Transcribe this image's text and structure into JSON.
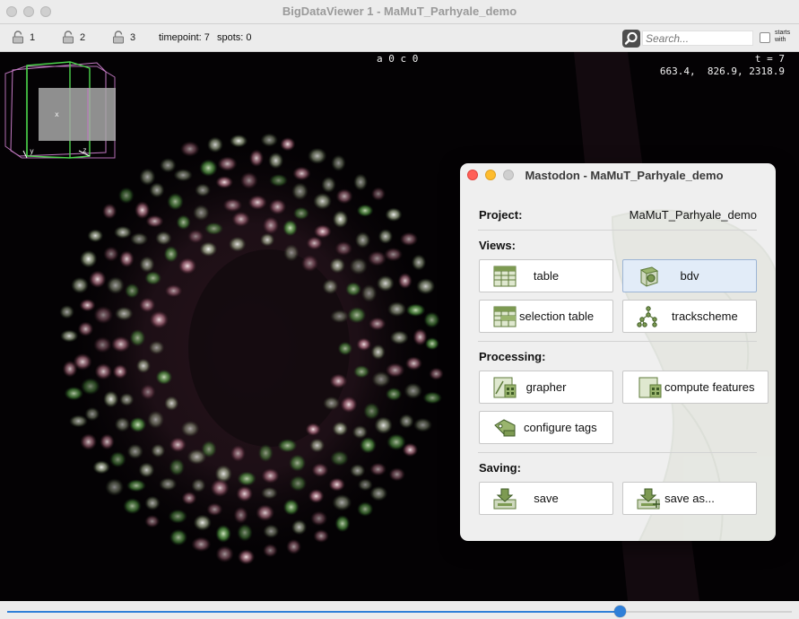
{
  "window": {
    "title": "BigDataViewer 1 - MaMuT_Parhyale_demo"
  },
  "toolbar": {
    "locks": [
      {
        "label": "1",
        "icon": "lock-icon"
      },
      {
        "label": "2",
        "icon": "lock-icon"
      },
      {
        "label": "3",
        "icon": "lock-icon"
      }
    ],
    "timepoint": "timepoint: 7",
    "spots": "spots: 0",
    "search_placeholder": "Search...",
    "starts_with": "starts with"
  },
  "viewer": {
    "source_info": "a 0 c 0",
    "timepoint_label": "t = 7",
    "coordinates": "663.4,  826.9, 2318.9",
    "minimap_axes": {
      "x": "x",
      "y": "y",
      "z": "z"
    }
  },
  "slider": {
    "value_fraction": 0.78
  },
  "mastodon": {
    "title": "Mastodon - MaMuT_Parhyale_demo",
    "project_label": "Project:",
    "project_name": "MaMuT_Parhyale_demo",
    "views_label": "Views:",
    "processing_label": "Processing:",
    "saving_label": "Saving:",
    "buttons": {
      "table": "table",
      "bdv": "bdv",
      "selection_table": "selection table",
      "trackscheme": "trackscheme",
      "grapher": "grapher",
      "compute_features": "compute features",
      "configure_tags": "configure tags",
      "save": "save",
      "save_as": "save as..."
    }
  },
  "colors": {
    "accent": "#2f7fd8",
    "selected_button": "#e2ecf8",
    "icon_green": "#6f8f45"
  }
}
